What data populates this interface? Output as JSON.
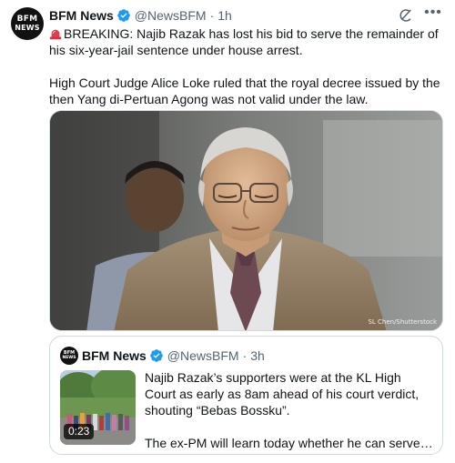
{
  "tweet": {
    "author": {
      "avatar_text_line1": "BFM",
      "avatar_text_line2": "NEWS",
      "name": "BFM News",
      "handle": "@NewsBFM",
      "separator": "·",
      "time": "1h",
      "verified_icon": "verified-badge-icon"
    },
    "actions": {
      "grok_icon": "grok-icon",
      "more_icon": "more-icon"
    },
    "text": {
      "siren_icon": "siren-emoji-icon",
      "paragraph1": "BREAKING: Najib Razak has lost his bid to serve the remainder of his six-year-jail sentence under house arrest.",
      "paragraph2": "High Court Judge Alice Loke ruled that the royal decree issued by the then Yang di-Pertuan Agong was not valid under the law."
    },
    "media": {
      "credit": "SL Chen/Shutterstock"
    },
    "quote": {
      "author": {
        "avatar_text_line1": "BFM",
        "avatar_text_line2": "NEWS",
        "name": "BFM News",
        "handle": "@NewsBFM",
        "separator": "·",
        "time": "3h"
      },
      "video_duration": "0:23",
      "paragraph1": "Najib Razak’s supporters were at the KL High Court as early as 8am ahead of his court verdict, shouting “Bebas Bossku”.",
      "paragraph2": "The ex-PM will learn today whether he can serve the ..."
    }
  },
  "colors": {
    "text_primary": "#0f1419",
    "text_secondary": "#536471",
    "verified_blue": "#1d9bf0",
    "border": "#cfd9de"
  }
}
